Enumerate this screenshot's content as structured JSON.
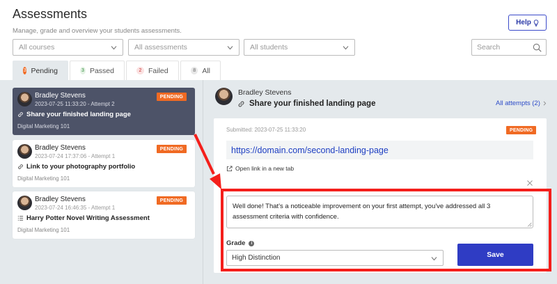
{
  "header": {
    "title": "Assessments",
    "subtitle": "Manage, grade and overview your students assessments.",
    "help_label": "Help"
  },
  "filters": {
    "courses": "All courses",
    "assessments": "All assessments",
    "students": "All students",
    "search_placeholder": "Search"
  },
  "tabs": [
    {
      "count": "3",
      "label": "Pending",
      "color": "#f06a23"
    },
    {
      "count": "3",
      "label": "Passed",
      "color": "#2e8b3a"
    },
    {
      "count": "2",
      "label": "Failed",
      "color": "#c53030"
    },
    {
      "count": "8",
      "label": "All",
      "color": "#666666"
    }
  ],
  "submissions": [
    {
      "name": "Bradley Stevens",
      "meta": "2023-07-25 11:33:20 - Attempt 2",
      "task": "Share your finished landing page",
      "task_icon": "link-icon",
      "course": "Digital Marketing 101",
      "status": "PENDING"
    },
    {
      "name": "Bradley Stevens",
      "meta": "2023-07-24 17:37:06 - Attempt 1",
      "task": "Link to your photography portfolio",
      "task_icon": "link-icon",
      "course": "Digital Marketing 101",
      "status": "PENDING"
    },
    {
      "name": "Bradley Stevens",
      "meta": "2023-07-24 16:46:35 - Attempt 1",
      "task": "Harry Potter Novel Writing Assessment",
      "task_icon": "list-icon",
      "course": "Digital Marketing 101",
      "status": "PENDING"
    }
  ],
  "detail": {
    "student_name": "Bradley Stevens",
    "task_title": "Share your finished landing page",
    "attempts_link": "All attempts (2)",
    "submitted": "Submitted: 2023-07-25 11:33:20",
    "status": "PENDING",
    "url": "https://domain.com/second-landing-page",
    "open_link_label": "Open link in a new tab",
    "feedback": "Well done! That's a noticeable improvement on your first attempt, you've addressed all 3 assessment criteria with confidence.",
    "grade_label": "Grade",
    "grade_value": "High Distinction",
    "save_label": "Save"
  },
  "colors": {
    "accent": "#2f3cc4",
    "pending": "#f06a23",
    "highlight": "#f41f1b",
    "selected_card": "#4d5368"
  }
}
